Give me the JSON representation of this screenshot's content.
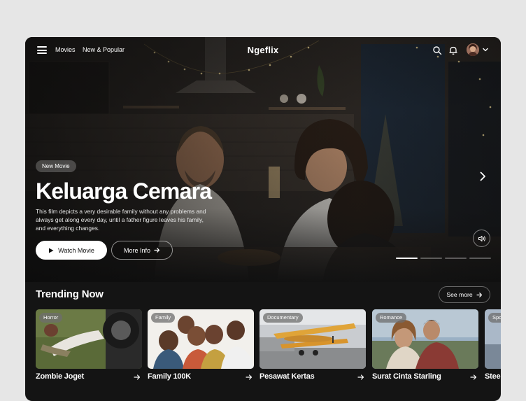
{
  "header": {
    "logo": "Ngeflix",
    "nav": [
      "Movies",
      "New & Popular"
    ],
    "icons": [
      "menu-icon",
      "search-icon",
      "bell-icon",
      "avatar",
      "chevron-down-icon"
    ]
  },
  "hero": {
    "badge": "New Movie",
    "title": "Keluarga Cemara",
    "description": "This film depicts a very desirable family without any problems and always get along every day, until a father figure leaves his family, and everything changes.",
    "watch_label": "Watch Movie",
    "more_label": "More Info",
    "slides_total": 4,
    "slide_active": 1
  },
  "trending": {
    "title": "Trending Now",
    "see_more": "See more",
    "cards": [
      {
        "genre": "Horror",
        "title": "Zombie Joget"
      },
      {
        "genre": "Family",
        "title": "Family 100K"
      },
      {
        "genre": "Documentary",
        "title": "Pesawat Kertas"
      },
      {
        "genre": "Romance",
        "title": "Surat Cinta Starling"
      },
      {
        "genre": "Spo",
        "title": "Stee"
      }
    ]
  },
  "colors": {
    "background": "#141414",
    "page": "#e6e6e6",
    "accent": "#ffffff"
  }
}
